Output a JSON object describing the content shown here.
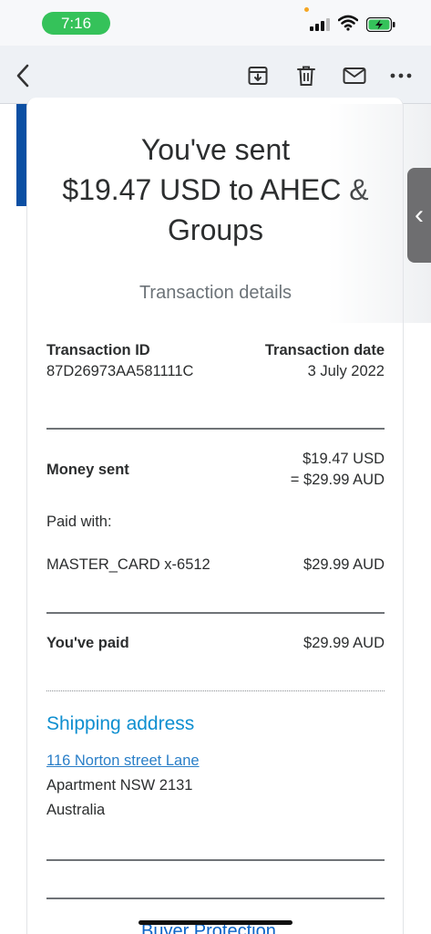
{
  "status_bar": {
    "time": "7:16",
    "accent": "#35c25a"
  },
  "toolbar": {
    "back_icon": "chevron-left-icon",
    "archive_icon": "archive-icon",
    "trash_icon": "trash-icon",
    "mail_icon": "mail-icon",
    "more_icon": "ellipsis-icon"
  },
  "email": {
    "headline_1": "You've sent",
    "headline_2": "$19.47 USD to AHEC &",
    "headline_3": "Groups",
    "subheading": "Transaction details",
    "transaction_id_label": "Transaction ID",
    "transaction_id": "87D26973AA581111C",
    "transaction_date_label": "Transaction date",
    "transaction_date": "3 July 2022",
    "money_sent_label": "Money sent",
    "money_sent_usd": "$19.47 USD",
    "money_sent_aud": "= $29.99 AUD",
    "paid_with_label": "Paid with:",
    "card_name": "MASTER_CARD x-6512",
    "card_amount": "$29.99 AUD",
    "paid_label": "You've paid",
    "paid_amount": "$29.99 AUD",
    "shipping_title": "Shipping address",
    "address_line_1": "116 Norton street Lane",
    "address_line_2": "Apartment NSW 2131",
    "address_line_3": "Australia",
    "next_section": "Buyer Protection",
    "link_color": "#0e8fd0",
    "brand_blue": "#0b4fa3"
  },
  "side_tab": {
    "label": "‹"
  }
}
